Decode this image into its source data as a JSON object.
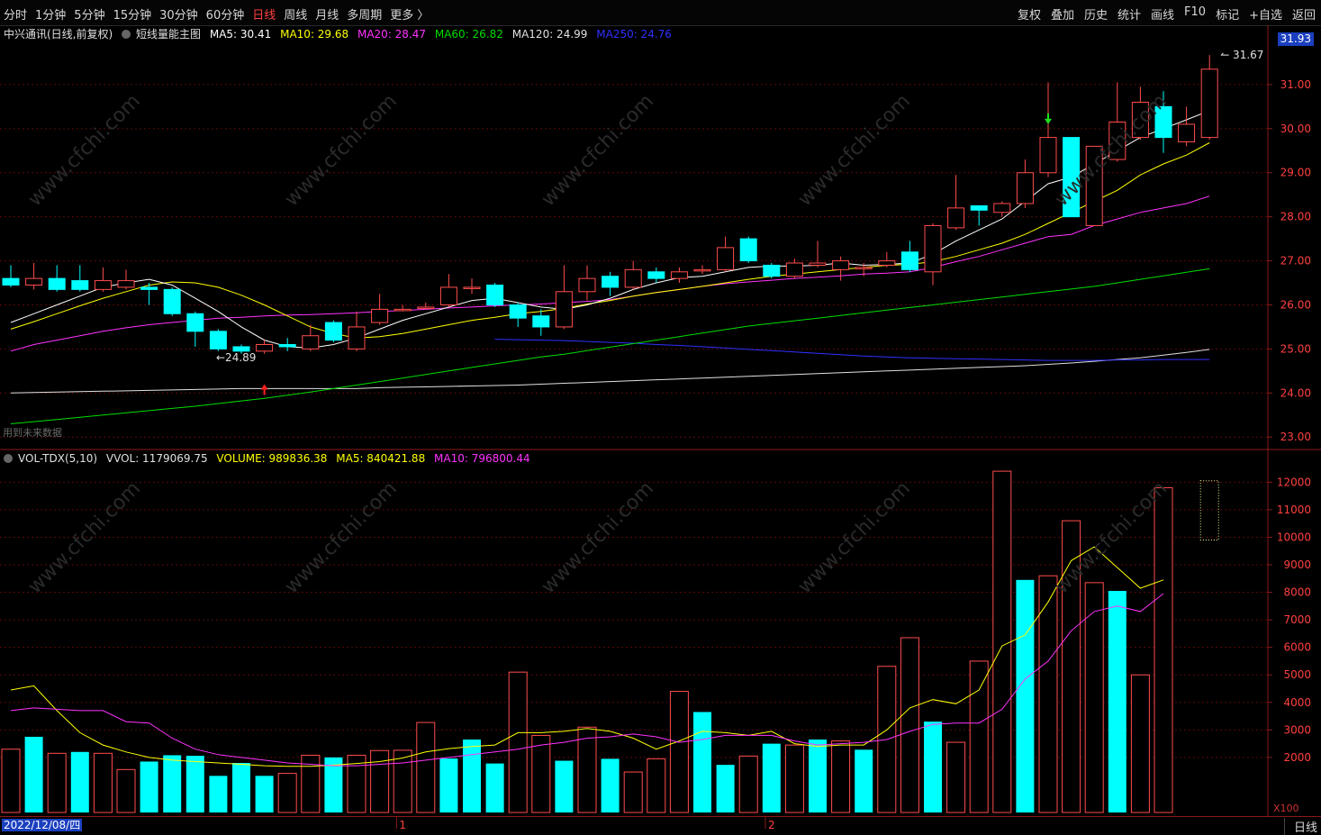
{
  "toolbar": {
    "periods": [
      "分时",
      "1分钟",
      "5分钟",
      "15分钟",
      "30分钟",
      "60分钟",
      "日线",
      "周线",
      "月线",
      "多周期",
      "更多 〉"
    ],
    "active_period": "日线",
    "tools": [
      "复权",
      "叠加",
      "历史",
      "统计",
      "画线",
      "F10",
      "标记",
      "+自选",
      "返回"
    ]
  },
  "main_legend": {
    "stock": "中兴通讯(日线,前复权)",
    "indicator": "短线量能主图",
    "ma5": "MA5: 30.41",
    "ma10": "MA10: 29.68",
    "ma20": "MA20: 28.47",
    "ma60": "MA60: 26.82",
    "ma120": "MA120: 24.99",
    "ma250": "MA250: 24.76"
  },
  "vol_legend": {
    "name": "VOL-TDX(5,10)",
    "vvol": "VVOL: 1179069.75",
    "volume": "VOLUME: 989836.38",
    "ma5": "MA5: 840421.88",
    "ma10": "MA10: 796800.44"
  },
  "footnote": "用到未来数据",
  "last_price": "31.93",
  "date_label": "2022/12/08/四",
  "period_tab": "日线",
  "unit_label": "X100",
  "annotations": {
    "high": "31.67",
    "low": "24.89"
  },
  "colors": {
    "up": "#ff4d4d",
    "down": "#00ffff",
    "ma5": "#ffffff",
    "ma10": "#ffff00",
    "ma20": "#ff33ff",
    "ma60": "#00dd00",
    "ma120": "#e0e0e0",
    "ma250": "#3030ff",
    "grid": "#5a0a0a",
    "axis_text": "#ff4040"
  },
  "chart_data": [
    {
      "type": "candlestick",
      "title": "中兴通讯(日线,前复权)",
      "ylim": [
        22.8,
        32.0
      ],
      "y_ticks": [
        23,
        24,
        25,
        26,
        27,
        28,
        29,
        30,
        31
      ],
      "x_ticks": [
        {
          "i": 17,
          "label": "1"
        },
        {
          "i": 33,
          "label": "2"
        }
      ],
      "candles": [
        [
          26.6,
          26.45,
          26.9,
          26.4
        ],
        [
          26.45,
          26.6,
          26.95,
          26.35
        ],
        [
          26.6,
          26.35,
          26.9,
          26.3
        ],
        [
          26.55,
          26.35,
          26.9,
          26.3
        ],
        [
          26.35,
          26.55,
          26.85,
          26.3
        ],
        [
          26.4,
          26.55,
          26.8,
          26.35
        ],
        [
          26.4,
          26.35,
          26.5,
          26.0
        ],
        [
          26.35,
          25.8,
          26.4,
          25.75
        ],
        [
          25.8,
          25.4,
          25.85,
          25.05
        ],
        [
          25.4,
          25.0,
          25.45,
          24.95
        ],
        [
          25.05,
          24.95,
          25.1,
          24.89
        ],
        [
          24.95,
          25.1,
          25.2,
          24.89
        ],
        [
          25.1,
          25.05,
          25.25,
          24.95
        ],
        [
          25.0,
          25.3,
          25.55,
          24.95
        ],
        [
          25.6,
          25.2,
          25.65,
          25.15
        ],
        [
          25.0,
          25.5,
          25.85,
          24.95
        ],
        [
          25.6,
          25.9,
          26.25,
          25.55
        ],
        [
          25.9,
          25.9,
          26.0,
          25.85
        ],
        [
          25.95,
          25.95,
          26.05,
          25.9
        ],
        [
          26.0,
          26.4,
          26.7,
          25.95
        ],
        [
          26.4,
          26.4,
          26.6,
          26.25
        ],
        [
          26.45,
          26.0,
          26.5,
          25.95
        ],
        [
          26.0,
          25.7,
          26.05,
          25.5
        ],
        [
          25.75,
          25.5,
          25.9,
          25.3
        ],
        [
          25.5,
          26.3,
          26.9,
          25.45
        ],
        [
          26.3,
          26.6,
          26.9,
          26.1
        ],
        [
          26.65,
          26.4,
          26.75,
          26.2
        ],
        [
          26.4,
          26.8,
          27.0,
          26.35
        ],
        [
          26.75,
          26.6,
          26.85,
          26.5
        ],
        [
          26.6,
          26.75,
          26.85,
          26.5
        ],
        [
          26.8,
          26.8,
          26.9,
          26.7
        ],
        [
          26.8,
          27.3,
          27.55,
          26.75
        ],
        [
          27.5,
          27.0,
          27.55,
          26.95
        ],
        [
          26.9,
          26.65,
          26.95,
          26.6
        ],
        [
          26.65,
          26.95,
          27.05,
          26.6
        ],
        [
          26.9,
          26.95,
          27.45,
          26.85
        ],
        [
          26.8,
          27.0,
          27.1,
          26.55
        ],
        [
          26.85,
          26.85,
          26.95,
          26.65
        ],
        [
          26.9,
          27.0,
          27.2,
          26.85
        ],
        [
          27.2,
          26.8,
          27.45,
          26.75
        ],
        [
          26.75,
          27.8,
          27.85,
          26.45
        ],
        [
          27.75,
          28.2,
          28.95,
          27.7
        ],
        [
          28.25,
          28.15,
          28.25,
          27.8
        ],
        [
          28.1,
          28.3,
          28.35,
          28.0
        ],
        [
          28.3,
          29.0,
          29.3,
          28.2
        ],
        [
          29.0,
          29.8,
          31.05,
          28.9
        ],
        [
          29.8,
          28.0,
          29.8,
          28.0
        ],
        [
          27.8,
          29.6,
          29.6,
          27.8
        ],
        [
          29.3,
          30.15,
          31.05,
          29.25
        ],
        [
          29.8,
          30.6,
          30.95,
          29.75
        ],
        [
          30.5,
          29.8,
          30.85,
          29.45
        ],
        [
          29.7,
          30.1,
          30.5,
          29.6
        ],
        [
          29.8,
          31.35,
          31.67,
          29.75
        ]
      ],
      "ma": {
        "ma5": [
          25.6,
          25.8,
          26.0,
          26.2,
          26.4,
          26.5,
          26.58,
          26.45,
          26.15,
          25.85,
          25.5,
          25.2,
          25.05,
          25.02,
          25.1,
          25.25,
          25.45,
          25.65,
          25.8,
          25.95,
          26.1,
          26.15,
          26.05,
          25.95,
          25.9,
          26.0,
          26.15,
          26.35,
          26.5,
          26.62,
          26.65,
          26.75,
          26.85,
          26.88,
          26.88,
          26.9,
          26.95,
          26.9,
          26.92,
          26.95,
          27.15,
          27.45,
          27.7,
          27.95,
          28.35,
          28.75,
          28.9,
          29.2,
          29.5,
          29.8,
          30.0,
          30.2,
          30.41
        ],
        "ma10": [
          25.45,
          25.62,
          25.8,
          25.98,
          26.15,
          26.3,
          26.45,
          26.52,
          26.5,
          26.4,
          26.22,
          26.0,
          25.75,
          25.5,
          25.35,
          25.25,
          25.28,
          25.35,
          25.45,
          25.55,
          25.65,
          25.72,
          25.8,
          25.85,
          25.92,
          26.02,
          26.1,
          26.2,
          26.28,
          26.35,
          26.42,
          26.5,
          26.58,
          26.65,
          26.7,
          26.75,
          26.8,
          26.85,
          26.9,
          26.92,
          26.98,
          27.1,
          27.25,
          27.4,
          27.6,
          27.85,
          28.1,
          28.35,
          28.6,
          28.95,
          29.2,
          29.4,
          29.68
        ],
        "ma20": [
          24.95,
          25.1,
          25.2,
          25.3,
          25.4,
          25.48,
          25.55,
          25.6,
          25.65,
          25.7,
          25.72,
          25.75,
          25.77,
          25.78,
          25.8,
          25.82,
          25.85,
          25.87,
          25.9,
          25.93,
          25.95,
          25.98,
          26.0,
          26.02,
          26.05,
          26.08,
          26.12,
          26.2,
          26.28,
          26.35,
          26.42,
          26.48,
          26.52,
          26.56,
          26.6,
          26.63,
          26.66,
          26.7,
          26.72,
          26.75,
          26.85,
          26.98,
          27.1,
          27.25,
          27.4,
          27.55,
          27.6,
          27.8,
          27.95,
          28.1,
          28.2,
          28.3,
          28.47
        ],
        "ma60": [
          23.3,
          23.35,
          23.4,
          23.45,
          23.5,
          23.55,
          23.6,
          23.65,
          23.7,
          23.76,
          23.82,
          23.88,
          23.95,
          24.02,
          24.1,
          24.18,
          24.26,
          24.34,
          24.42,
          24.5,
          24.58,
          24.66,
          24.74,
          24.82,
          24.88,
          24.96,
          25.04,
          25.12,
          25.2,
          25.28,
          25.36,
          25.44,
          25.52,
          25.58,
          25.64,
          25.7,
          25.76,
          25.82,
          25.88,
          25.94,
          26.0,
          26.06,
          26.12,
          26.18,
          26.24,
          26.3,
          26.36,
          26.42,
          26.5,
          26.58,
          26.66,
          26.74,
          26.82
        ],
        "ma120": [
          24.0,
          24.01,
          24.02,
          24.03,
          24.04,
          24.05,
          24.06,
          24.07,
          24.08,
          24.09,
          24.1,
          24.1,
          24.1,
          24.1,
          24.1,
          24.1,
          24.12,
          24.13,
          24.14,
          24.15,
          24.16,
          24.17,
          24.18,
          24.2,
          24.22,
          24.24,
          24.26,
          24.28,
          24.3,
          24.32,
          24.34,
          24.36,
          24.38,
          24.4,
          24.42,
          24.44,
          24.46,
          24.48,
          24.5,
          24.52,
          24.54,
          24.56,
          24.58,
          24.6,
          24.62,
          24.65,
          24.68,
          24.72,
          24.76,
          24.8,
          24.86,
          24.92,
          24.99
        ],
        "ma250": [
          null,
          null,
          null,
          null,
          null,
          null,
          null,
          null,
          null,
          null,
          null,
          null,
          null,
          null,
          null,
          null,
          null,
          null,
          null,
          null,
          null,
          25.22,
          25.21,
          25.2,
          25.19,
          25.17,
          25.15,
          25.13,
          25.1,
          25.08,
          25.05,
          25.02,
          24.99,
          24.96,
          24.93,
          24.9,
          24.87,
          24.84,
          24.82,
          24.8,
          24.79,
          24.78,
          24.77,
          24.76,
          24.75,
          24.74,
          24.74,
          24.74,
          24.75,
          24.75,
          24.76,
          24.76,
          24.76
        ]
      }
    },
    {
      "type": "bar",
      "title": "VOL-TDX(5,10)",
      "ylim": [
        0,
        12600
      ],
      "unit": "X100",
      "y_ticks": [
        2000,
        3000,
        4000,
        5000,
        6000,
        7000,
        8000,
        9000,
        10000,
        11000,
        12000
      ],
      "volumes": [
        2300,
        2750,
        2150,
        2200,
        2150,
        1560,
        1850,
        2080,
        2060,
        1330,
        1800,
        1330,
        1420,
        2080,
        2000,
        2080,
        2250,
        2260,
        3270,
        1960,
        2650,
        1780,
        5100,
        2800,
        1880,
        3100,
        1950,
        1470,
        1950,
        4400,
        3650,
        1730,
        2050,
        2500,
        2450,
        2650,
        2600,
        2280,
        5310,
        6350,
        3300,
        2550,
        5500,
        12400,
        8450,
        8600,
        10600,
        8350,
        8050,
        5000,
        11800
      ],
      "vol_down": [
        false,
        true,
        false,
        true,
        false,
        false,
        true,
        true,
        true,
        true,
        true,
        true,
        false,
        false,
        true,
        false,
        false,
        false,
        false,
        true,
        true,
        true,
        false,
        false,
        true,
        false,
        true,
        false,
        false,
        false,
        true,
        true,
        false,
        true,
        false,
        true,
        false,
        true,
        false,
        false,
        true,
        false,
        false,
        false,
        true,
        false,
        false,
        false,
        true,
        false,
        false
      ],
      "ma5": [
        4450,
        4600,
        3700,
        2900,
        2450,
        2200,
        2000,
        1900,
        1850,
        1800,
        1750,
        1700,
        1680,
        1680,
        1720,
        1780,
        1850,
        1980,
        2200,
        2320,
        2400,
        2450,
        2900,
        2900,
        2950,
        3050,
        2950,
        2700,
        2300,
        2600,
        2950,
        2900,
        2800,
        2950,
        2500,
        2400,
        2450,
        2450,
        3000,
        3800,
        4100,
        3950,
        4450,
        6050,
        6450,
        7650,
        9150,
        9650,
        8900,
        8150,
        8450
      ],
      "ma10": [
        3700,
        3800,
        3750,
        3700,
        3700,
        3300,
        3250,
        2700,
        2300,
        2100,
        2000,
        1900,
        1800,
        1750,
        1700,
        1700,
        1750,
        1800,
        1900,
        2000,
        2100,
        2200,
        2300,
        2450,
        2550,
        2700,
        2750,
        2850,
        2750,
        2550,
        2650,
        2800,
        2800,
        2800,
        2600,
        2450,
        2500,
        2550,
        2650,
        2950,
        3200,
        3250,
        3250,
        3750,
        4850,
        5500,
        6600,
        7300,
        7500,
        7300,
        7950
      ]
    }
  ]
}
